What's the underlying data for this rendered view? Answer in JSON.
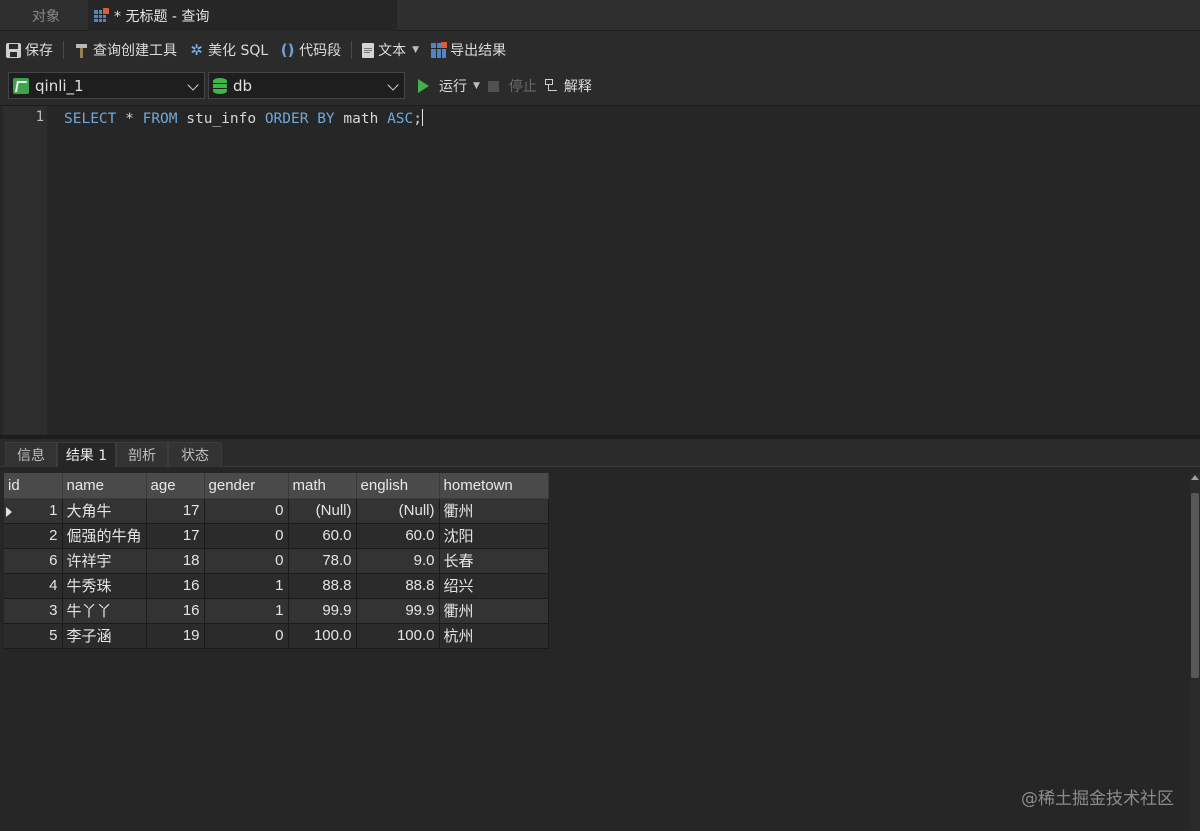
{
  "tabs": {
    "objects": "对象",
    "query": "* 无标题 - 查询"
  },
  "toolbar": {
    "save": "保存",
    "query_builder": "查询创建工具",
    "beautify": "美化 SQL",
    "snippet": "代码段",
    "text": "文本",
    "export": "导出结果"
  },
  "connection": {
    "connection_name": "qinli_1",
    "database": "db",
    "run": "运行",
    "stop": "停止",
    "explain": "解释"
  },
  "editor": {
    "line_number": "1",
    "tokens": [
      "SELECT",
      " * ",
      "FROM",
      " stu_info ",
      "ORDER BY",
      " math ",
      "ASC",
      ";"
    ]
  },
  "result_tabs": [
    "信息",
    "结果 1",
    "剖析",
    "状态"
  ],
  "results": {
    "columns": [
      "id",
      "name",
      "age",
      "gender",
      "math",
      "english",
      "hometown"
    ],
    "rows": [
      [
        "1",
        "大角牛",
        "17",
        "0",
        "(Null)",
        "(Null)",
        "衢州"
      ],
      [
        "2",
        "倔强的牛角",
        "17",
        "0",
        "60.0",
        "60.0",
        "沈阳"
      ],
      [
        "6",
        "许祥宇",
        "18",
        "0",
        "78.0",
        "9.0",
        "长春"
      ],
      [
        "4",
        "牛秀珠",
        "16",
        "1",
        "88.8",
        "88.8",
        "绍兴"
      ],
      [
        "3",
        "牛丫丫",
        "16",
        "1",
        "99.9",
        "99.9",
        "衢州"
      ],
      [
        "5",
        "李子涵",
        "19",
        "0",
        "100.0",
        "100.0",
        "杭州"
      ]
    ]
  },
  "watermark": "@稀土掘金技术社区"
}
